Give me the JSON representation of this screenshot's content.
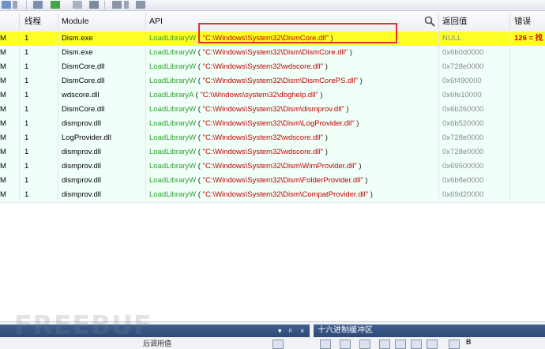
{
  "columns": {
    "thread": "线程",
    "module": "Module",
    "api": "API",
    "return_value": "返回值",
    "error": "错误"
  },
  "rows": [
    {
      "m": "M",
      "thread": "1",
      "module": "Dism.exe",
      "fn": "LoadLibraryW",
      "arg": "\"C:\\Windows\\System32\\DismCore.dll\"",
      "ret": "NULL",
      "err": "126 = 找",
      "highlight": true
    },
    {
      "m": "M",
      "thread": "1",
      "module": "Dism.exe",
      "fn": "LoadLibraryW",
      "arg": "\"C:\\Windows\\System32\\Dism\\DismCore.dll\"",
      "ret": "0x6b0d0000",
      "err": ""
    },
    {
      "m": "M",
      "thread": "1",
      "module": "DismCore.dll",
      "fn": "LoadLibraryW",
      "arg": "\"C:\\Windows\\System32\\wdscore.dll\"",
      "ret": "0x728e0000",
      "err": ""
    },
    {
      "m": "M",
      "thread": "1",
      "module": "DismCore.dll",
      "fn": "LoadLibraryW",
      "arg": "\"C:\\Windows\\System32\\Dism\\DismCorePS.dll\"",
      "ret": "0x6f490000",
      "err": ""
    },
    {
      "m": "M",
      "thread": "1",
      "module": "wdscore.dll",
      "fn": "LoadLibraryA",
      "arg": "\"C:\\Windows\\system32\\dbghelp.dll\"",
      "ret": "0x6fe10000",
      "err": ""
    },
    {
      "m": "M",
      "thread": "1",
      "module": "DismCore.dll",
      "fn": "LoadLibraryW",
      "arg": "\"C:\\Windows\\System32\\Dism\\dismprov.dll\"",
      "ret": "0x6b260000",
      "err": ""
    },
    {
      "m": "M",
      "thread": "1",
      "module": "dismprov.dll",
      "fn": "LoadLibraryW",
      "arg": "\"C:\\Windows\\System32\\Dism\\LogProvider.dll\"",
      "ret": "0x6b520000",
      "err": ""
    },
    {
      "m": "M",
      "thread": "1",
      "module": "LogProvider.dll",
      "fn": "LoadLibraryW",
      "arg": "\"C:\\Windows\\System32\\wdscore.dll\"",
      "ret": "0x728e0000",
      "err": ""
    },
    {
      "m": "M",
      "thread": "1",
      "module": "dismprov.dll",
      "fn": "LoadLibraryW",
      "arg": "\"C:\\Windows\\System32\\wdscore.dll\"",
      "ret": "0x728e0000",
      "err": ""
    },
    {
      "m": "M",
      "thread": "1",
      "module": "dismprov.dll",
      "fn": "LoadLibraryW",
      "arg": "\"C:\\Windows\\System32\\Dism\\WimProvider.dll\"",
      "ret": "0x69500000",
      "err": ""
    },
    {
      "m": "M",
      "thread": "1",
      "module": "dismprov.dll",
      "fn": "LoadLibraryW",
      "arg": "\"C:\\Windows\\System32\\Dism\\FolderProvider.dll\"",
      "ret": "0x6b8e0000",
      "err": ""
    },
    {
      "m": "M",
      "thread": "1",
      "module": "dismprov.dll",
      "fn": "LoadLibraryW",
      "arg": "\"C:\\Windows\\System32\\Dism\\CompatProvider.dll\"",
      "ret": "0x69d20000",
      "err": ""
    }
  ],
  "bottom": {
    "hex_buffer_title": "十六进制缓冲区",
    "left_panel_label": "后调用值",
    "watermark": "FREEBUF"
  },
  "colors": {
    "row_bg": "#f0fff8",
    "highlight_bg": "#ffff28",
    "function_green": "#2c9f2c",
    "string_red": "#c00000",
    "error_red": "#e00000",
    "annotation_box": "#e53030"
  },
  "icons": [
    "arrow-icon",
    "list-view-icon",
    "refresh-icon",
    "copy-icon",
    "save-icon",
    "filter-icon",
    "trash-icon",
    "search-icon"
  ]
}
